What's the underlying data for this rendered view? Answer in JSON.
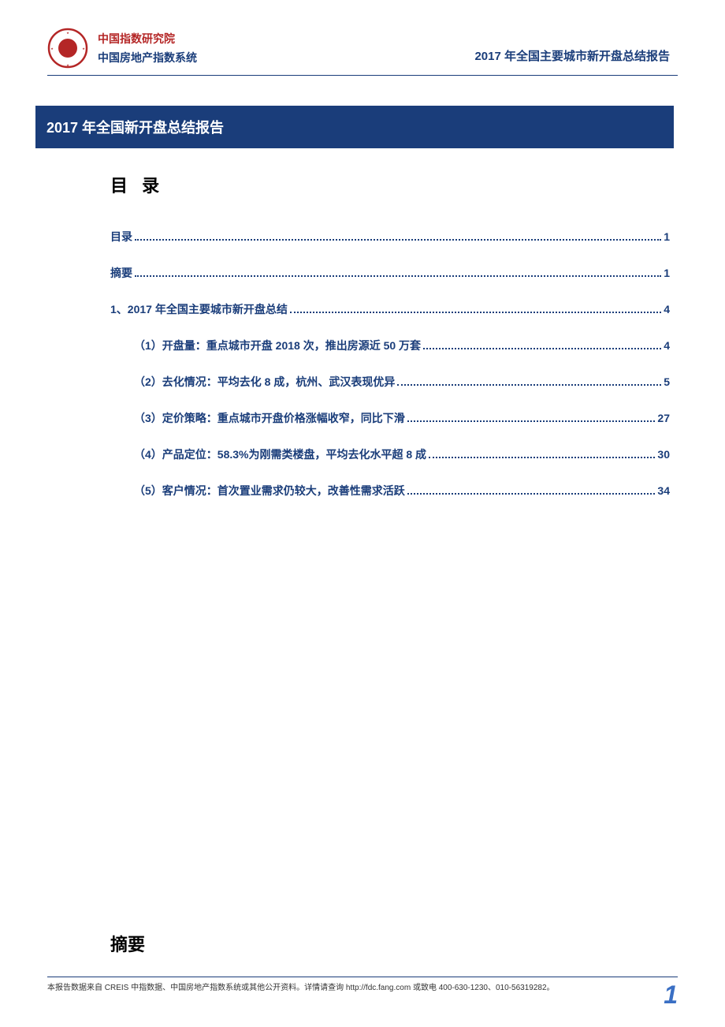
{
  "header": {
    "org_line1": "中国指数研究院",
    "org_line2": "中国房地产指数系统",
    "doc_title": "2017 年全国主要城市新开盘总结报告"
  },
  "title_bar": "2017 年全国新开盘总结报告",
  "toc_heading": "目 录",
  "toc": [
    {
      "label": "目录",
      "page": "1",
      "indent": 0
    },
    {
      "label": "摘要",
      "page": "1",
      "indent": 0
    },
    {
      "label": "1、2017 年全国主要城市新开盘总结",
      "page": "4",
      "indent": 0
    },
    {
      "label": "（1）开盘量：重点城市开盘 2018 次，推出房源近 50 万套",
      "page": "4",
      "indent": 1
    },
    {
      "label": "（2）去化情况：平均去化 8 成，杭州、武汉表现优异",
      "page": "5",
      "indent": 1
    },
    {
      "label": "（3）定价策略：重点城市开盘价格涨幅收窄，同比下滑",
      "page": "27",
      "indent": 1
    },
    {
      "label": "（4）产品定位：58.3%为刚需类楼盘，平均去化水平超 8 成",
      "page": "30",
      "indent": 1
    },
    {
      "label": "（5）客户情况：首次置业需求仍较大，改善性需求活跃",
      "page": "34",
      "indent": 1
    }
  ],
  "abstract_heading": "摘要",
  "footer": {
    "text": "本报告数据来自 CREIS 中指数据、中国房地产指数系统或其他公开资料。详情请查询 http://fdc.fang.com 或致电 400-630-1230、010-56319282。",
    "page_number": "1"
  }
}
